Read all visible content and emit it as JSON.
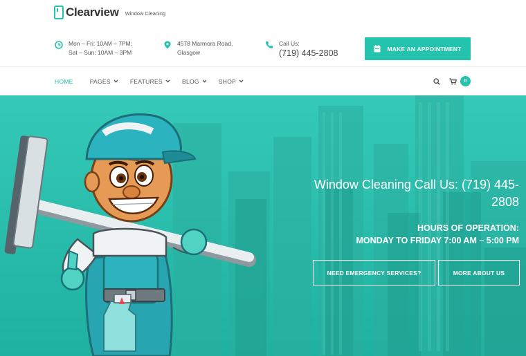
{
  "brand": {
    "name": "Clearview",
    "tagline": "Window Cleaning",
    "accent": "#23c3ad"
  },
  "header": {
    "hours": {
      "icon": "clock-icon",
      "line1": "Mon – Fri: 10AM – 7PM;",
      "line2": "Sat – Sun: 10AM – 3PM"
    },
    "address": {
      "icon": "location-pin-icon",
      "line1": "4578 Marmora Road,",
      "line2": "Glasgow"
    },
    "phone": {
      "icon": "phone-icon",
      "label": "Call Us:",
      "number": "(719) 445-2808"
    },
    "cta_label": "MAKE AN APPOINTMENT"
  },
  "nav": {
    "items": [
      {
        "label": "HOME",
        "active": true
      },
      {
        "label": "PAGES"
      },
      {
        "label": "FEATURES"
      },
      {
        "label": "BLOG"
      },
      {
        "label": "SHOP"
      }
    ],
    "cart_count": "0"
  },
  "hero": {
    "headline_line1": "Window Cleaning Call Us: (719) 445-",
    "headline_line2": "2808",
    "hours_line1": "HOURS OF OPERATION:",
    "hours_line2": "MONDAY TO FRIDAY 7:00 AM – 5:00 PM",
    "btn_emergency": "NEED EMERGENCY SERVICES?",
    "btn_about": "MORE ABOUT US"
  }
}
